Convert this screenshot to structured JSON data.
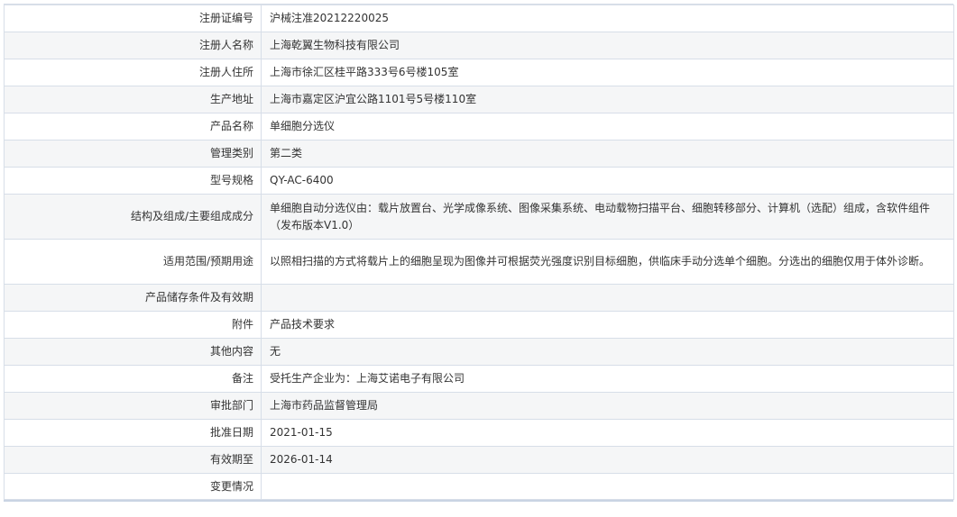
{
  "rows": [
    {
      "label": "注册证编号",
      "value": "沪械注准20212220025"
    },
    {
      "label": "注册人名称",
      "value": "上海乾翼生物科技有限公司"
    },
    {
      "label": "注册人住所",
      "value": "上海市徐汇区桂平路333号6号楼105室"
    },
    {
      "label": "生产地址",
      "value": "上海市嘉定区沪宜公路1101号5号楼110室"
    },
    {
      "label": "产品名称",
      "value": "单细胞分选仪"
    },
    {
      "label": "管理类别",
      "value": "第二类"
    },
    {
      "label": "型号规格",
      "value": "QY-AC-6400"
    },
    {
      "label": "结构及组成/主要组成成分",
      "value": "单细胞自动分选仪由：载片放置台、光学成像系统、图像采集系统、电动载物扫描平台、细胞转移部分、计算机（选配）组成，含软件组件（发布版本V1.0）"
    },
    {
      "label": "适用范围/预期用途",
      "value": "以照相扫描的方式将载片上的细胞呈现为图像并可根据荧光强度识别目标细胞，供临床手动分选单个细胞。分选出的细胞仅用于体外诊断。"
    },
    {
      "label": "产品储存条件及有效期",
      "value": ""
    },
    {
      "label": "附件",
      "value": "产品技术要求"
    },
    {
      "label": "其他内容",
      "value": "无"
    },
    {
      "label": "备注",
      "value": "受托生产企业为：上海艾诺电子有限公司"
    },
    {
      "label": "审批部门",
      "value": "上海市药品监督管理局"
    },
    {
      "label": "批准日期",
      "value": "2021-01-15"
    },
    {
      "label": "有效期至",
      "value": "2026-01-14"
    },
    {
      "label": "变更情况",
      "value": ""
    }
  ]
}
